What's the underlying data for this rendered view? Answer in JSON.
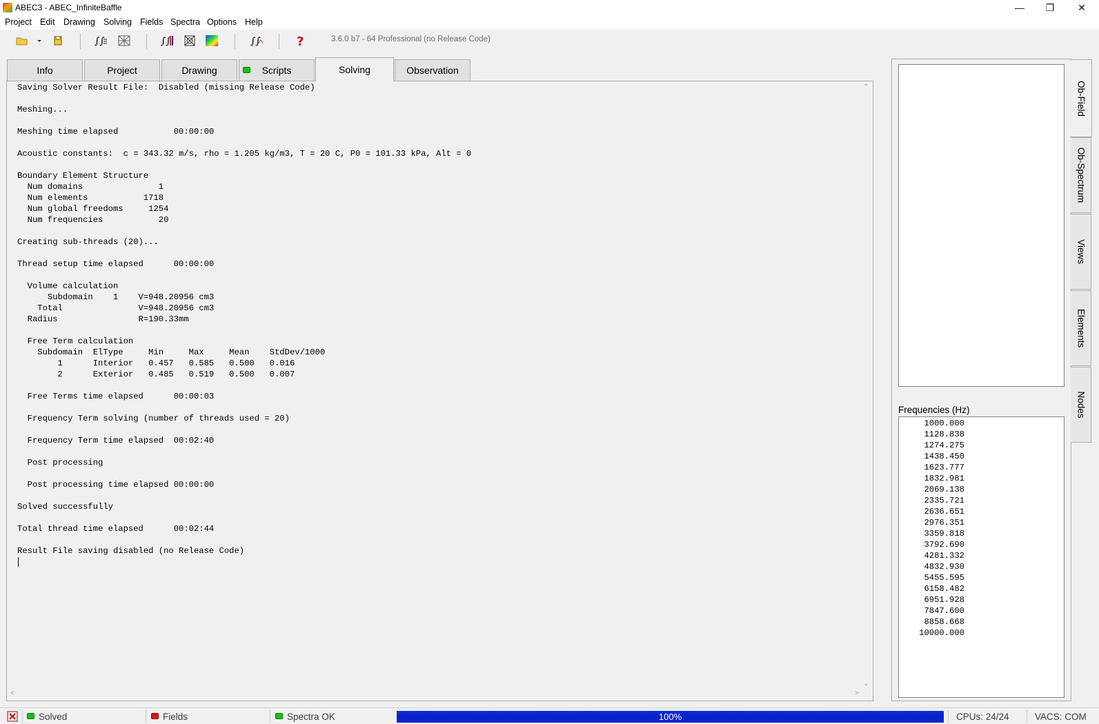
{
  "window": {
    "title": "ABEC3 - ABEC_InfiniteBaffle"
  },
  "menu": [
    "Project",
    "Edit",
    "Drawing",
    "Solving",
    "Fields",
    "Spectra",
    "Options",
    "Help"
  ],
  "toolbar": {
    "version": "3.6.0 b7 - 64 Professional (no Release Code)"
  },
  "tabs": [
    "Info",
    "Project",
    "Drawing",
    "Scripts",
    "Solving",
    "Observation"
  ],
  "log": {
    "lines": [
      "Saving Solver Result File:  Disabled (missing Release Code)",
      "",
      "Meshing...",
      "",
      "Meshing time elapsed           00:00:00",
      "",
      "Acoustic constants:  c = 343.32 m/s, rho = 1.205 kg/m3, T = 20 C, P0 = 101.33 kPa, Alt = 0",
      "",
      "Boundary Element Structure",
      "  Num domains               1",
      "  Num elements           1718",
      "  Num global freedoms     1254",
      "  Num frequencies           20",
      "",
      "Creating sub-threads (20)...",
      "",
      "Thread setup time elapsed      00:00:00",
      "",
      "  Volume calculation",
      "      Subdomain    1    V=948.20956 cm3",
      "    Total               V=948.20956 cm3",
      "  Radius                R=190.33mm",
      "",
      "  Free Term calculation",
      "    Subdomain  ElType     Min     Max     Mean    StdDev/1000",
      "        1      Interior   0.457   0.585   0.500   0.016",
      "        2      Exterior   0.485   0.519   0.500   0.007",
      "",
      "  Free Terms time elapsed      00:00:03",
      "",
      "  Frequency Term solving (number of threads used = 20)",
      "",
      "  Frequency Term time elapsed  00:02:40",
      "",
      "  Post processing",
      "",
      "  Post processing time elapsed 00:00:00",
      "",
      "Solved successfully",
      "",
      "Total thread time elapsed      00:02:44",
      "",
      "Result File saving disabled (no Release Code)"
    ]
  },
  "side_tabs": [
    "Ob-Field",
    "Ob-Spectrum",
    "Views",
    "Elements",
    "Nodes"
  ],
  "frequencies": {
    "label": "Frequencies  (Hz)",
    "values": [
      "1000.000",
      "1128.838",
      "1274.275",
      "1438.450",
      "1623.777",
      "1832.981",
      "2069.138",
      "2335.721",
      "2636.651",
      "2976.351",
      "3359.818",
      "3792.690",
      "4281.332",
      "4832.930",
      "5455.595",
      "6158.482",
      "6951.928",
      "7847.600",
      "8858.668",
      "10000.000"
    ]
  },
  "status": {
    "solved": "Solved",
    "fields": "Fields",
    "spectra": "Spectra OK",
    "progress_value": 1.0,
    "progress_label": "100%",
    "cpus": "CPUs: 24/24",
    "vacs": "VACS: COM"
  },
  "colors": {
    "progress": "#0b22cc",
    "led_green": "#16c216",
    "led_red": "#e0141e"
  }
}
